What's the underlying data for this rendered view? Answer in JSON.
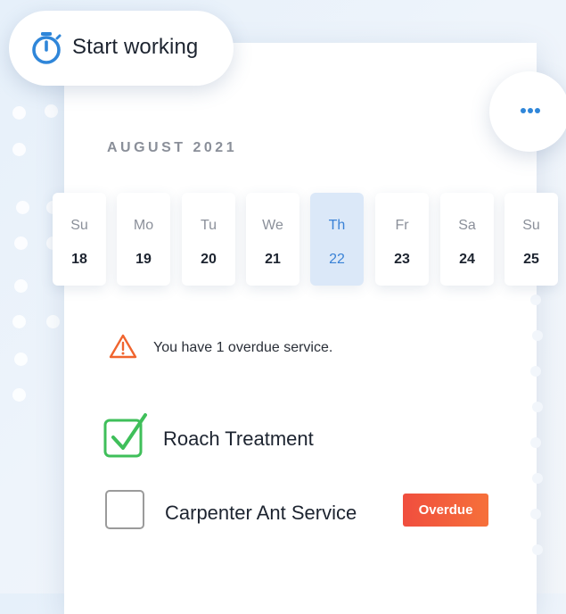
{
  "start_button": {
    "label": "Start working",
    "icon": "stopwatch-icon",
    "color": "#2f86d9"
  },
  "more_button": {
    "icon": "more-dots-icon",
    "color": "#2f86d9"
  },
  "calendar": {
    "month_label": "AUGUST 2021",
    "selected_index": 4,
    "days": [
      {
        "name": "Su",
        "num": "18"
      },
      {
        "name": "Mo",
        "num": "19"
      },
      {
        "name": "Tu",
        "num": "20"
      },
      {
        "name": "We",
        "num": "21"
      },
      {
        "name": "Th",
        "num": "22"
      },
      {
        "name": "Fr",
        "num": "23"
      },
      {
        "name": "Sa",
        "num": "24"
      },
      {
        "name": "Su",
        "num": "25"
      }
    ]
  },
  "warning": {
    "icon": "warning-triangle-icon",
    "text": "You have 1 overdue service.",
    "color": "#f0642e"
  },
  "tasks": [
    {
      "label": "Roach Treatment",
      "checked": true,
      "check_color": "#3fbf5a"
    },
    {
      "label": "Carpenter Ant Service",
      "checked": false,
      "badge": "Overdue",
      "badge_color": "#f25a3c"
    }
  ]
}
